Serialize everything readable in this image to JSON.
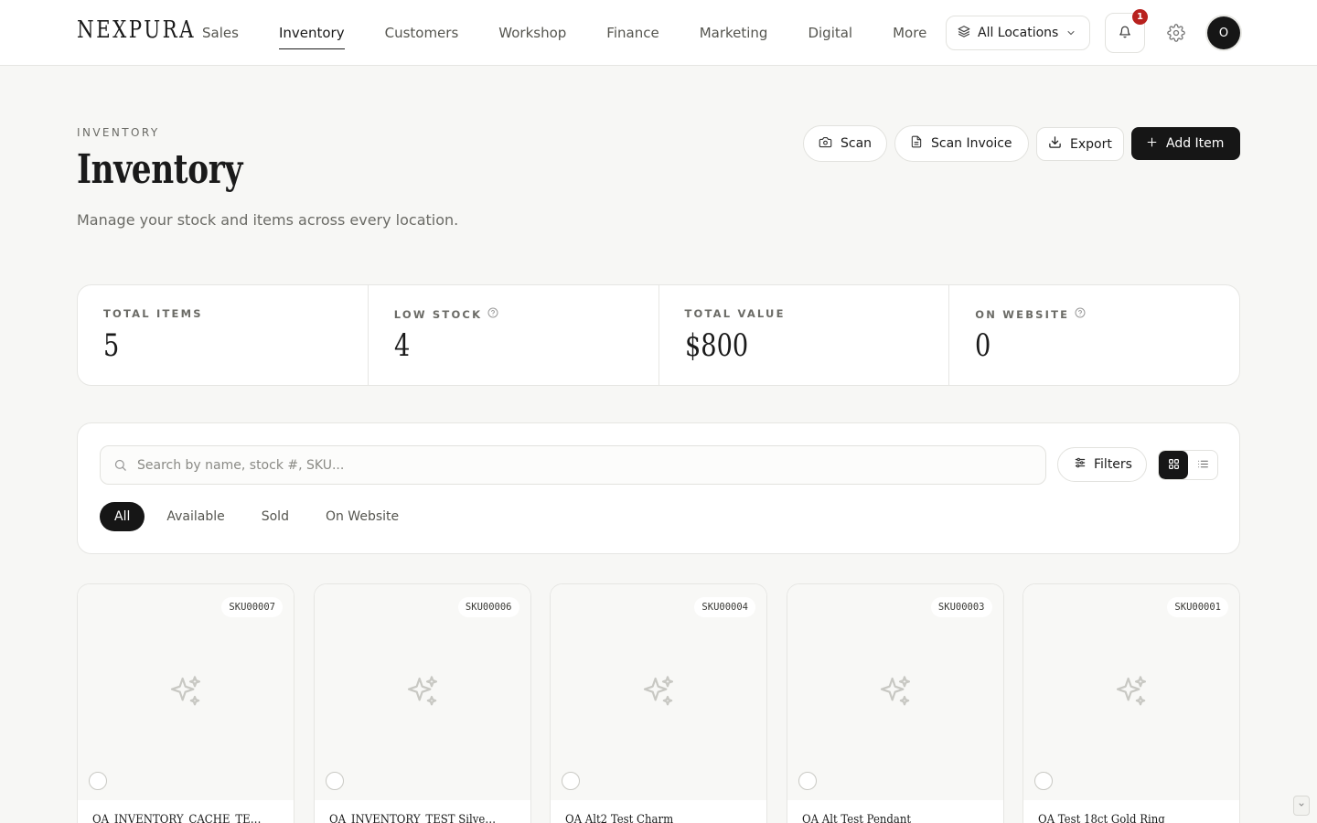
{
  "brand": {
    "logo": "NEXPURA"
  },
  "nav": [
    {
      "label": "Sales",
      "active": false
    },
    {
      "label": "Inventory",
      "active": true
    },
    {
      "label": "Customers",
      "active": false
    },
    {
      "label": "Workshop",
      "active": false
    },
    {
      "label": "Finance",
      "active": false
    },
    {
      "label": "Marketing",
      "active": false
    },
    {
      "label": "Digital",
      "active": false
    },
    {
      "label": "More",
      "active": false
    }
  ],
  "topbar": {
    "location_label": "All Locations",
    "notification_count": "1",
    "avatar_initial": "O"
  },
  "header": {
    "eyebrow": "INVENTORY",
    "title": "Inventory",
    "subtitle": "Manage your stock and items across every location.",
    "buttons": {
      "scan": "Scan",
      "scan_invoice": "Scan Invoice",
      "export": "Export",
      "add_item": "Add Item"
    }
  },
  "stats": [
    {
      "label": "TOTAL ITEMS",
      "value": "5",
      "help": false
    },
    {
      "label": "LOW STOCK",
      "value": "4",
      "help": true
    },
    {
      "label": "TOTAL VALUE",
      "value": "$800",
      "help": false
    },
    {
      "label": "ON WEBSITE",
      "value": "0",
      "help": true
    }
  ],
  "filters": {
    "search_placeholder": "Search by name, stock #, SKU...",
    "search_value": "",
    "filters_label": "Filters",
    "view_mode": "grid",
    "tabs": [
      {
        "label": "All",
        "active": true
      },
      {
        "label": "Available",
        "active": false
      },
      {
        "label": "Sold",
        "active": false
      },
      {
        "label": "On Website",
        "active": false
      }
    ]
  },
  "items": [
    {
      "sku": "SKU00007",
      "name": "QA_INVENTORY_CACHE_TEST Item"
    },
    {
      "sku": "SKU00006",
      "name": "QA_INVENTORY_TEST Silver Bangle"
    },
    {
      "sku": "SKU00004",
      "name": "QA Alt2 Test Charm"
    },
    {
      "sku": "SKU00003",
      "name": "QA Alt Test Pendant"
    },
    {
      "sku": "SKU00001",
      "name": "QA Test 18ct Gold Ring"
    }
  ],
  "colors": {
    "accent": "#161616",
    "badge": "#b8211e",
    "background": "#f7f7f5"
  }
}
